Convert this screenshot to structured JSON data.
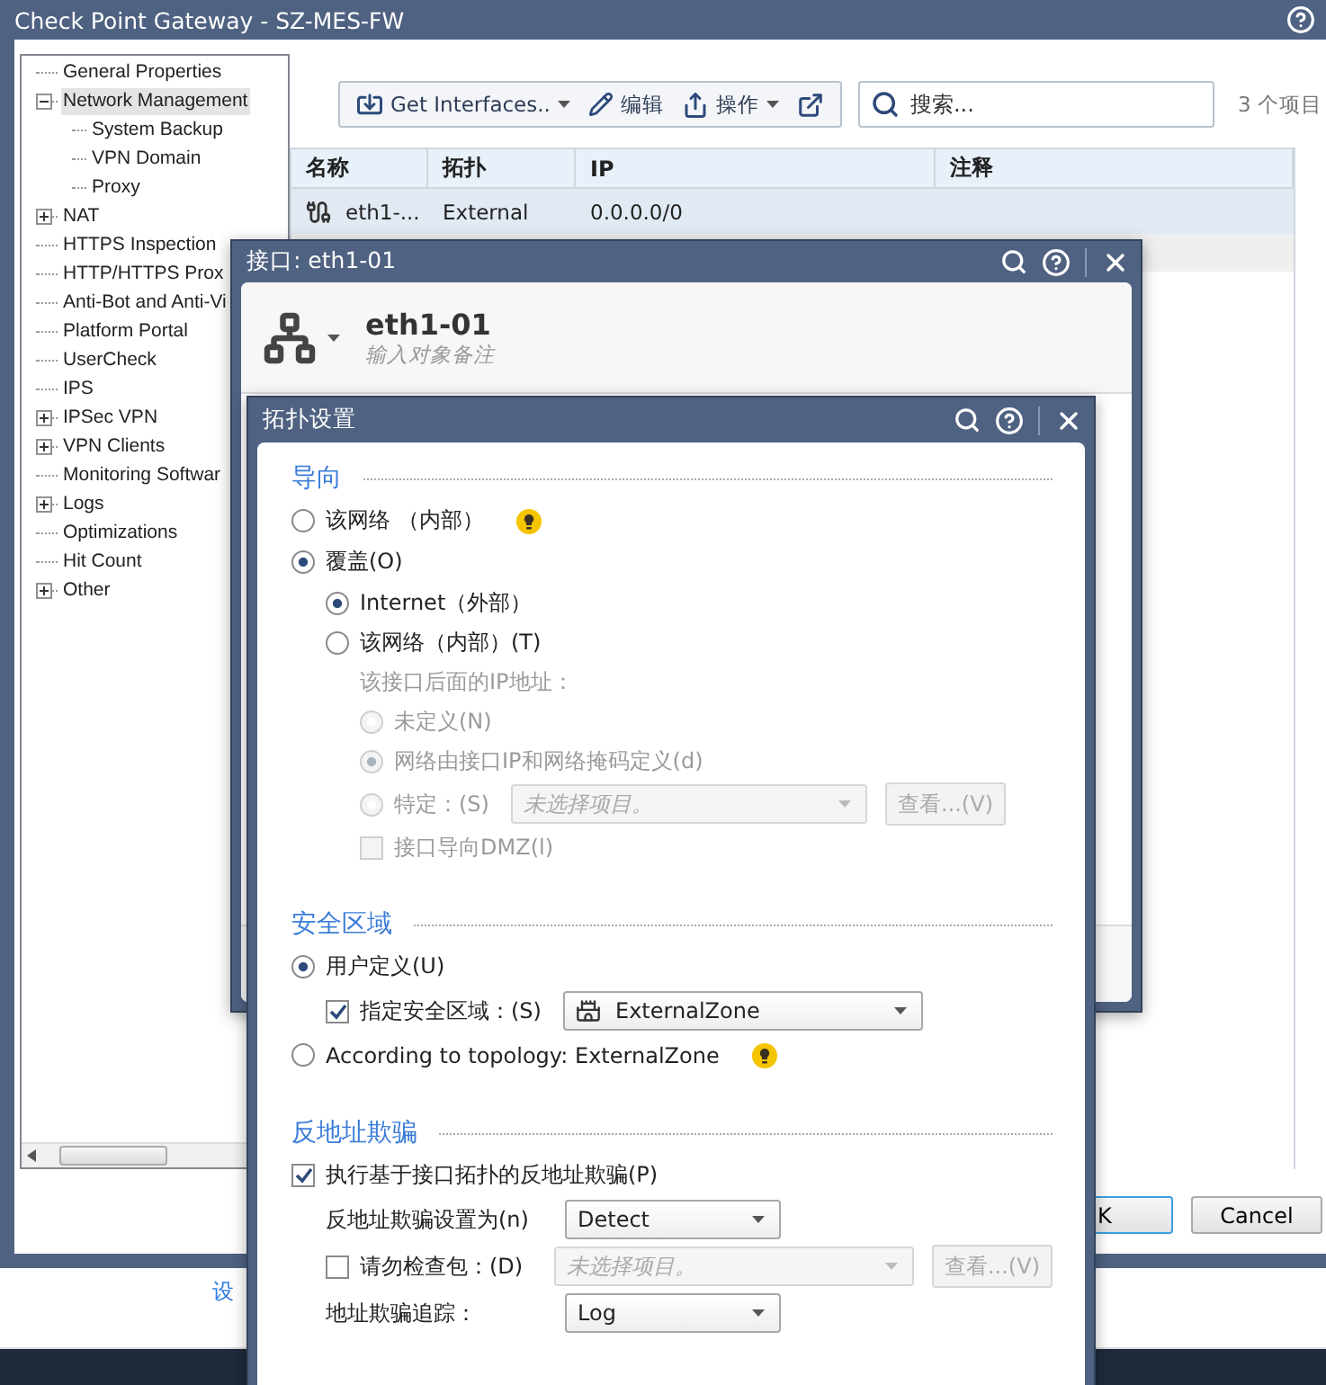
{
  "window": {
    "title": "Check Point Gateway - SZ-MES-FW"
  },
  "tree": [
    {
      "label": "General Properties",
      "selected": false
    },
    {
      "label": "Network Management",
      "selected": true,
      "expanded": true,
      "children": [
        {
          "label": "System Backup",
          "selected": false
        },
        {
          "label": "VPN Domain",
          "selected": false
        },
        {
          "label": "Proxy",
          "selected": false
        }
      ]
    },
    {
      "label": "NAT",
      "selected": false,
      "expanded": false
    },
    {
      "label": "HTTPS Inspection",
      "selected": false
    },
    {
      "label": "HTTP/HTTPS Prox",
      "selected": false
    },
    {
      "label": "Anti-Bot and Anti-Vi",
      "selected": false
    },
    {
      "label": "Platform Portal",
      "selected": false
    },
    {
      "label": "UserCheck",
      "selected": false
    },
    {
      "label": "IPS",
      "selected": false
    },
    {
      "label": "IPSec VPN",
      "selected": false,
      "expanded": false
    },
    {
      "label": "VPN Clients",
      "selected": false,
      "expanded": false
    },
    {
      "label": "Monitoring Softwar",
      "selected": false
    },
    {
      "label": "Logs",
      "selected": false,
      "expanded": false
    },
    {
      "label": "Optimizations",
      "selected": false
    },
    {
      "label": "Hit Count",
      "selected": false
    },
    {
      "label": "Other",
      "selected": false,
      "expanded": false
    }
  ],
  "toolbar": [
    {
      "kind": "import",
      "label": "Get Interfaces..",
      "menu": true
    },
    {
      "kind": "edit",
      "label": "编辑",
      "menu": false
    },
    {
      "kind": "share",
      "label": "操作",
      "menu": true
    },
    {
      "kind": "popout"
    }
  ],
  "search": {
    "placeholder": "搜索..."
  },
  "item_count": "3 个项目",
  "table": {
    "columns": [
      "名称",
      "拓扑",
      "IP",
      "注释"
    ],
    "rows": [
      {
        "selected": true,
        "cells": [
          "eth1-...",
          "External",
          "0.0.0.0/0"
        ]
      }
    ]
  },
  "buttons": [
    {
      "label": "K",
      "default": true
    },
    {
      "label": "Cancel",
      "default": false
    }
  ],
  "footer_link": "设",
  "interface_dialog": {
    "title": "接口: eth1-01",
    "name": "eth1-01",
    "comment_placeholder": "输入对象备注"
  },
  "topology_dialog": {
    "title": "拓扑设置",
    "sections": [
      {
        "heading": "导向",
        "rows": [
          {
            "kind": "radio",
            "label": "该网络 （内部）",
            "selected": false,
            "tip": true
          },
          {
            "kind": "radio",
            "label": "覆盖(O)",
            "selected": true,
            "children": [
              {
                "kind": "radio",
                "label": "Internet（外部）",
                "selected": true
              },
              {
                "kind": "radio",
                "label": "该网络（内部）(T)",
                "selected": false,
                "children": [
                  {
                    "kind": "text",
                    "label": "该接口后面的IP地址：",
                    "disabled": true
                  },
                  {
                    "kind": "radio",
                    "label": "未定义(N)",
                    "selected": false,
                    "disabled": true
                  },
                  {
                    "kind": "radio",
                    "label": "网络由接口IP和网络掩码定义(d)",
                    "selected": true,
                    "disabled": true
                  },
                  {
                    "kind": "radio",
                    "label": "特定：(S)",
                    "selected": false,
                    "disabled": true,
                    "select": {
                      "placeholder": "未选择项目。",
                      "disabled": true
                    },
                    "button": {
                      "label": "查看...(V)",
                      "disabled": true
                    }
                  },
                  {
                    "kind": "checkbox",
                    "label": "接口导向DMZ(l)",
                    "checked": false,
                    "disabled": true
                  }
                ]
              }
            ]
          }
        ]
      },
      {
        "heading": "安全区域",
        "rows": [
          {
            "kind": "radio",
            "label": "用户定义(U)",
            "selected": true,
            "children": [
              {
                "kind": "checkbox",
                "label": "指定安全区域：(S)",
                "checked": true,
                "select": {
                  "value": "ExternalZone",
                  "disabled": false
                }
              }
            ]
          },
          {
            "kind": "radio",
            "label": "According to topology: ExternalZone",
            "selected": false,
            "tip": true
          }
        ]
      },
      {
        "heading": "反地址欺骗",
        "rows": [
          {
            "kind": "checkbox",
            "label": "执行基于接口拓扑的反地址欺骗(P)",
            "checked": true,
            "children": [
              {
                "kind": "text",
                "label": "反地址欺骗设置为(n)",
                "select": {
                  "value": "Detect",
                  "disabled": false
                }
              },
              {
                "kind": "checkbox",
                "label": "请勿检查包：(D)",
                "checked": false,
                "select": {
                  "placeholder": "未选择项目。",
                  "disabled": true
                },
                "button": {
                  "label": "查看...(V)",
                  "disabled": true
                }
              },
              {
                "kind": "text",
                "label": "地址欺骗追踪：",
                "select": {
                  "value": "Log",
                  "disabled": false
                }
              }
            ]
          }
        ]
      }
    ]
  }
}
